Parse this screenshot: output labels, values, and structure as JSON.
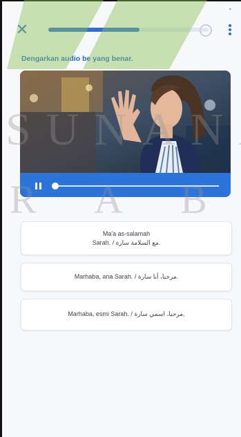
{
  "header": {
    "close_icon": "close-icon",
    "progress_fraction": 0.57,
    "more_icon": "more-vertical-icon"
  },
  "instruction": "Dengarkan audio be                    yang benar.",
  "video": {
    "pause_icon": "pause-icon",
    "seek_fraction": 0.0
  },
  "options": [
    {
      "line1": "Ma'a as-salamah",
      "line2": "Sarah. / مع السلامة سارة."
    },
    {
      "line1": "Marhaba, ana Sarah. / مرحبا، أنا سارة."
    },
    {
      "line1": "Marhaba, esmi Sarah. / مرحبا، اسمي سارة."
    }
  ],
  "watermark": {
    "line1": "SUNANA",
    "line2": "R A B"
  },
  "colors": {
    "accent": "#2f6fd6",
    "controls_bar": "#2c74d9",
    "background": "#f7f8fa",
    "watermark_green": "#8fc25a"
  }
}
